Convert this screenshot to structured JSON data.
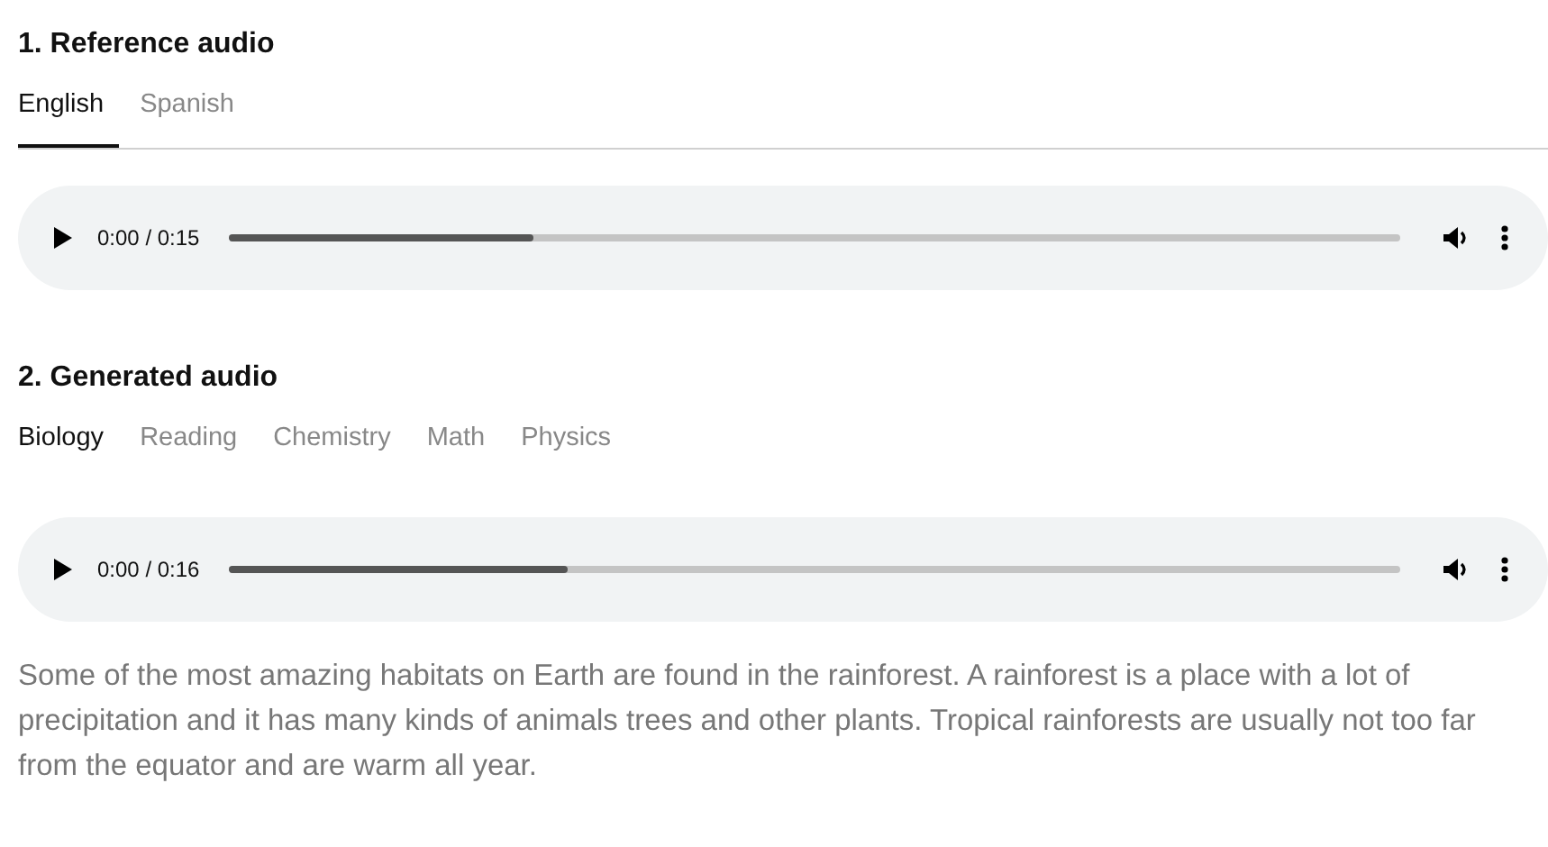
{
  "sections": [
    {
      "title": "1. Reference audio",
      "divider": true,
      "tabs": [
        {
          "label": "English",
          "selected": true
        },
        {
          "label": "Spanish",
          "selected": false
        }
      ],
      "player": {
        "time": "0:00 / 0:15",
        "level": 0.26
      }
    },
    {
      "title": "2. Generated audio",
      "divider": false,
      "tabs": [
        {
          "label": "Biology",
          "selected": true
        },
        {
          "label": "Reading",
          "selected": false
        },
        {
          "label": "Chemistry",
          "selected": false
        },
        {
          "label": "Math",
          "selected": false
        },
        {
          "label": "Physics",
          "selected": false
        }
      ],
      "player": {
        "time": "0:00 / 0:16",
        "level": 0.29
      },
      "text": "Some of the most amazing habitats on Earth are found in the rainforest. A rainforest is a place with a lot of precipitation and it has many kinds of animals trees and other plants. Tropical rainforests are usually not too far from the equator and are warm all year."
    }
  ]
}
